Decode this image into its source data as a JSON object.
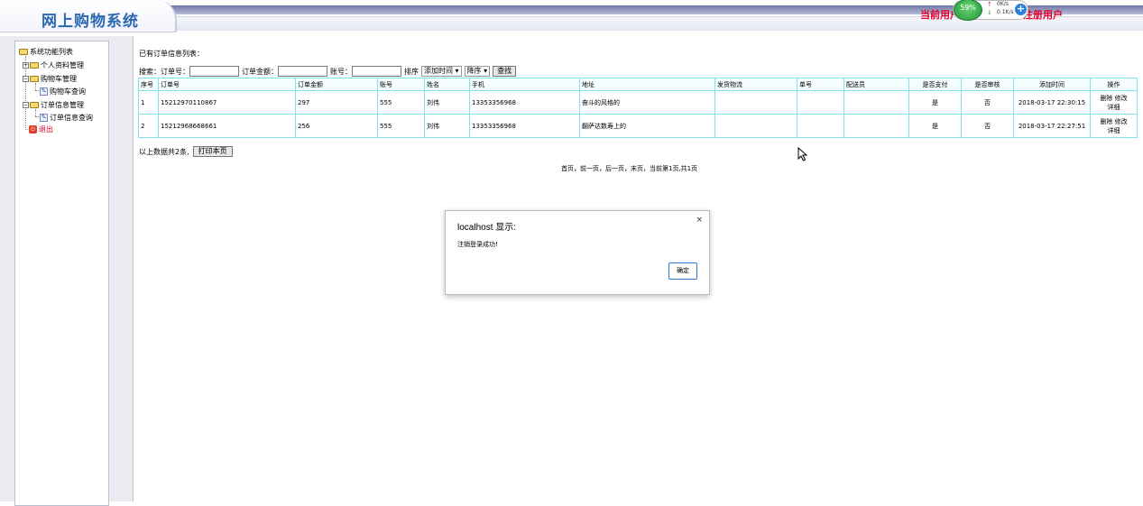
{
  "header": {
    "site_title": "网上购物系统",
    "user_info_left": "当前用户",
    "user_info_right": "注册用户",
    "net_widget": {
      "percent": "59%",
      "up_speed": "0K/s",
      "down_speed": "0.1K/s"
    }
  },
  "sidebar": {
    "root": "系统功能列表",
    "items": [
      {
        "label": "个人资料管理"
      },
      {
        "label": "购物车管理"
      },
      {
        "label": "购物车查询"
      },
      {
        "label": "订单信息管理"
      },
      {
        "label": "订单信息查询"
      },
      {
        "label": "退出"
      }
    ]
  },
  "main": {
    "list_title": "已有订单信息列表：",
    "search": {
      "prefix": "搜索：",
      "order_no_label": "订单号：",
      "amount_label": "订单金额：",
      "account_label": "账号：",
      "sort_label": "排序",
      "sort_field": "添加时间",
      "sort_order": "降序",
      "search_button": "查找"
    },
    "table": {
      "headers": [
        "序号",
        "订单号",
        "订单金额",
        "账号",
        "姓名",
        "手机",
        "地址",
        "发货物流",
        "单号",
        "配送员",
        "是否支付",
        "是否审核",
        "添加时间",
        "操作"
      ],
      "rows": [
        {
          "no": "1",
          "order_no": "15212970110867",
          "amount": "297",
          "account": "555",
          "name": "刘伟",
          "phone": "13353356968",
          "address": "奋斗的风格的",
          "logistics": "",
          "tracking": "",
          "courier": "",
          "paid": "是",
          "reviewed": "否",
          "added": "2018-03-17 22:30:15",
          "ops_line1": "删除 修改",
          "ops_line2": "详细"
        },
        {
          "no": "2",
          "order_no": "15212968668661",
          "amount": "256",
          "account": "555",
          "name": "刘伟",
          "phone": "13353356968",
          "address": "翻萨达数寿上的",
          "logistics": "",
          "tracking": "",
          "courier": "",
          "paid": "是",
          "reviewed": "否",
          "added": "2018-03-17 22:27:51",
          "ops_line1": "删除 修改",
          "ops_line2": "详细"
        }
      ]
    },
    "summary": "以上数据共2条,",
    "print_button": "打印本页",
    "pager": "首页，前一页，后一页，末页，当前第1页,共1页"
  },
  "dialog": {
    "title": "localhost 显示:",
    "message": "注销登录成功!",
    "ok_label": "确定",
    "close_glyph": "×"
  }
}
